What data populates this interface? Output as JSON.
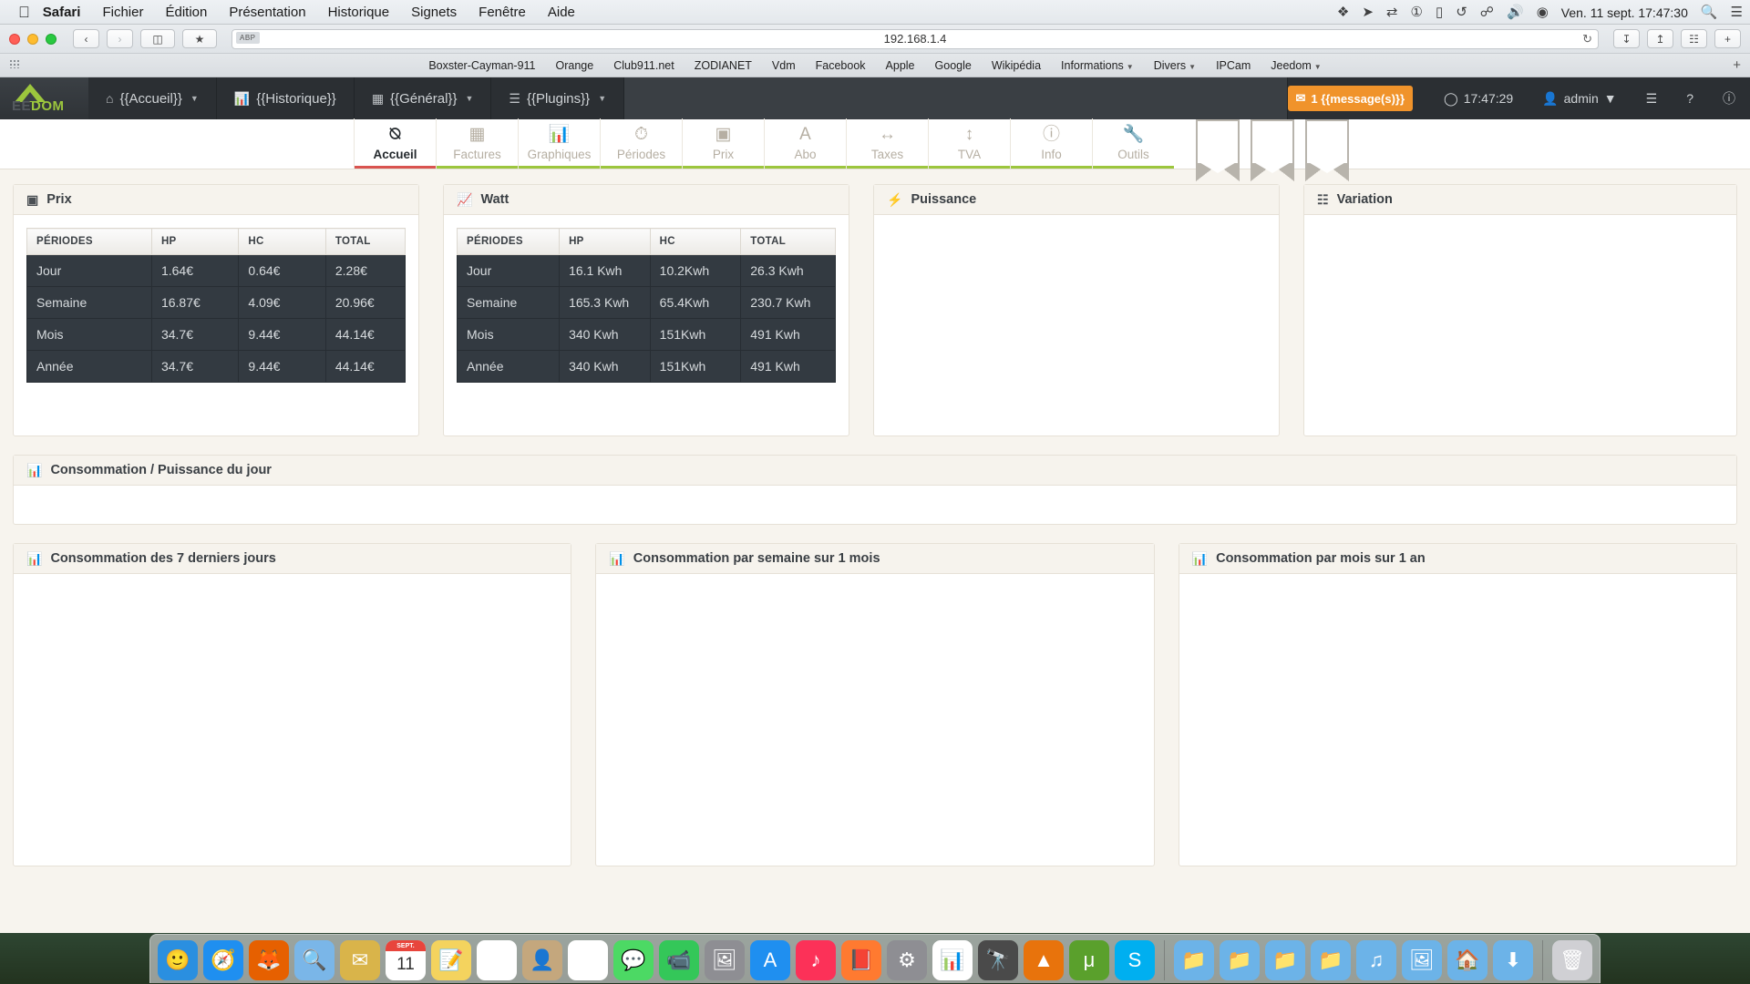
{
  "menubar": {
    "apple_icon": "apple-icon",
    "items": [
      {
        "label": "Safari",
        "bold": true
      },
      {
        "label": "Fichier",
        "bold": false
      },
      {
        "label": "Édition",
        "bold": false
      },
      {
        "label": "Présentation",
        "bold": false
      },
      {
        "label": "Historique",
        "bold": false
      },
      {
        "label": "Signets",
        "bold": false
      },
      {
        "label": "Fenêtre",
        "bold": false
      },
      {
        "label": "Aide",
        "bold": false
      }
    ],
    "status_icons": [
      "dropbox-icon",
      "chevron-right-icon",
      "teamviewer-icon",
      "one-password-icon",
      "airplay-icon",
      "time-machine-icon",
      "bluetooth-icon",
      "volume-icon",
      "wifi-icon"
    ],
    "clock": "Ven. 11 sept. 17:47:30",
    "search_icon": "search-icon",
    "control_center_icon": "list-icon"
  },
  "safari_toolbar": {
    "back_label": "‹",
    "forward_label": "›",
    "sidebar_icon": "sidebar-icon",
    "bookmarks_icon": "star-icon",
    "reader_badge": "ABP",
    "url": "192.168.1.4",
    "reload_icon": "reload-icon",
    "download_icon": "download-icon",
    "share_icon": "share-icon",
    "tabs_icon": "tabs-icon",
    "new_tab_icon": "plus-icon"
  },
  "bookmarks_bar": [
    {
      "label": "Boxster-Cayman-911",
      "dropdown": false
    },
    {
      "label": "Orange",
      "dropdown": false
    },
    {
      "label": "Club911.net",
      "dropdown": false
    },
    {
      "label": "ZODIANET",
      "dropdown": false
    },
    {
      "label": "Vdm",
      "dropdown": false
    },
    {
      "label": "Facebook",
      "dropdown": false
    },
    {
      "label": "Apple",
      "dropdown": false
    },
    {
      "label": "Google",
      "dropdown": false
    },
    {
      "label": "Wikipédia",
      "dropdown": false
    },
    {
      "label": "Informations",
      "dropdown": true
    },
    {
      "label": "Divers",
      "dropdown": true
    },
    {
      "label": "IPCam",
      "dropdown": false
    },
    {
      "label": "Jeedom",
      "dropdown": true
    }
  ],
  "jeedom_nav": {
    "logo": {
      "dim": "EE",
      "lime": "DOM",
      "full": "JEEDOM"
    },
    "items": [
      {
        "label": "{{Accueil}}",
        "icon": "home-icon",
        "dropdown": true
      },
      {
        "label": "{{Historique}}",
        "icon": "chart-bar-icon",
        "dropdown": false
      },
      {
        "label": "{{Général}}",
        "icon": "qrcode-icon",
        "dropdown": true
      },
      {
        "label": "{{Plugins}}",
        "icon": "list-icon",
        "dropdown": true
      }
    ],
    "message_badge": {
      "icon": "envelope-icon",
      "label": "1 {{message(s)}}"
    },
    "clock": {
      "icon": "clock-icon",
      "label": "17:47:29"
    },
    "user": {
      "icon": "user-icon",
      "label": "admin",
      "dropdown": true
    },
    "right_icons": [
      "sitemap-icon",
      "help-icon",
      "info-icon"
    ]
  },
  "tabs": [
    {
      "label": "Accueil",
      "icon": "dashboard-icon",
      "active": true
    },
    {
      "label": "Factures",
      "icon": "table-icon",
      "active": false
    },
    {
      "label": "Graphiques",
      "icon": "bar-chart-icon",
      "active": false
    },
    {
      "label": "Périodes",
      "icon": "clock-icon",
      "active": false
    },
    {
      "label": "Prix",
      "icon": "money-icon",
      "active": false
    },
    {
      "label": "Abo",
      "icon": "font-icon",
      "active": false
    },
    {
      "label": "Taxes",
      "icon": "text-width-icon",
      "active": false
    },
    {
      "label": "TVA",
      "icon": "text-height-icon",
      "active": false
    },
    {
      "label": "Info",
      "icon": "info-circle-icon",
      "active": false
    },
    {
      "label": "Outils",
      "icon": "wrench-icon",
      "active": false
    }
  ],
  "bookmark_shapes": [
    "bookmark-icon",
    "bookmark-icon",
    "bookmark-icon"
  ],
  "panels": {
    "prix": {
      "title": "Prix",
      "icon": "money-icon",
      "headers": [
        "PÉRIODES",
        "HP",
        "HC",
        "TOTAL"
      ],
      "rows": [
        [
          "Jour",
          "1.64€",
          "0.64€",
          "2.28€"
        ],
        [
          "Semaine",
          "16.87€",
          "4.09€",
          "20.96€"
        ],
        [
          "Mois",
          "34.7€",
          "9.44€",
          "44.14€"
        ],
        [
          "Année",
          "34.7€",
          "9.44€",
          "44.14€"
        ]
      ]
    },
    "watt": {
      "title": "Watt",
      "icon": "signal-icon",
      "headers": [
        "PÉRIODES",
        "HP",
        "HC",
        "TOTAL"
      ],
      "rows": [
        [
          "Jour",
          "16.1 Kwh",
          "10.2Kwh",
          "26.3 Kwh"
        ],
        [
          "Semaine",
          "165.3 Kwh",
          "65.4Kwh",
          "230.7 Kwh"
        ],
        [
          "Mois",
          "340 Kwh",
          "151Kwh",
          "491 Kwh"
        ],
        [
          "Année",
          "340 Kwh",
          "151Kwh",
          "491 Kwh"
        ]
      ]
    },
    "puissance": {
      "title": "Puissance",
      "icon": "bolt-icon"
    },
    "variation": {
      "title": "Variation",
      "icon": "list-alt-icon"
    },
    "conso_jour": {
      "title": "Consommation / Puissance du jour",
      "icon": "bar-chart-icon"
    },
    "conso_7j": {
      "title": "Consommation des 7 derniers jours",
      "icon": "bar-chart-icon"
    },
    "conso_semaine": {
      "title": "Consommation par semaine sur 1 mois",
      "icon": "bar-chart-icon"
    },
    "conso_mois": {
      "title": "Consommation par mois sur 1 an",
      "icon": "bar-chart-icon"
    }
  },
  "colors": {
    "accent_lime": "#9cc63d",
    "active_tab_underline": "#d9534f",
    "badge_orange": "#f0932b",
    "navbar_dark": "#2b2f33",
    "table_row_dark": "#333a41",
    "page_bg": "#f7f4ee"
  },
  "dock": {
    "items": [
      {
        "name": "finder-icon",
        "glyph": "🙂",
        "color": "#2a8fe0"
      },
      {
        "name": "safari-icon",
        "glyph": "🧭",
        "color": "#1f8ff0"
      },
      {
        "name": "firefox-icon",
        "glyph": "🦊",
        "color": "#e66000"
      },
      {
        "name": "preview-icon",
        "glyph": "🔍",
        "color": "#7ab6e8"
      },
      {
        "name": "mail-icon",
        "glyph": "✉",
        "color": "#d9b44a"
      },
      {
        "name": "calendar-icon",
        "glyph": "11",
        "color": "#ffffff",
        "cal_month": "SEPT."
      },
      {
        "name": "notes-icon",
        "glyph": "📝",
        "color": "#f4d35e"
      },
      {
        "name": "numbers-icon",
        "glyph": "▦",
        "color": "#ffffff"
      },
      {
        "name": "contacts-icon",
        "glyph": "👤",
        "color": "#c4a77d"
      },
      {
        "name": "photos-icon",
        "glyph": "✿",
        "color": "#ffffff"
      },
      {
        "name": "messages-icon",
        "glyph": "💬",
        "color": "#4cd964"
      },
      {
        "name": "facetime-icon",
        "glyph": "📹",
        "color": "#34c759"
      },
      {
        "name": "screenshot-icon",
        "glyph": "🖼",
        "color": "#8e8e93"
      },
      {
        "name": "appstore-icon",
        "glyph": "A",
        "color": "#1f8ff0"
      },
      {
        "name": "itunes-icon",
        "glyph": "♪",
        "color": "#fc3158"
      },
      {
        "name": "ibooks-icon",
        "glyph": "📕",
        "color": "#ff7a30"
      },
      {
        "name": "settings-icon",
        "glyph": "⚙",
        "color": "#8e8e93"
      },
      {
        "name": "activity-icon",
        "glyph": "📊",
        "color": "#ffffff"
      },
      {
        "name": "telescope-icon",
        "glyph": "🔭",
        "color": "#4a4a4a"
      },
      {
        "name": "vlc-icon",
        "glyph": "▲",
        "color": "#e8730c"
      },
      {
        "name": "utorrent-icon",
        "glyph": "μ",
        "color": "#5aa02c"
      },
      {
        "name": "skype-icon",
        "glyph": "S",
        "color": "#00aff0"
      },
      {
        "name": "folder-icon",
        "glyph": "📁",
        "color": "#6cb3e8"
      },
      {
        "name": "folder-icon",
        "glyph": "📁",
        "color": "#6cb3e8"
      },
      {
        "name": "folder-icon",
        "glyph": "📁",
        "color": "#6cb3e8"
      },
      {
        "name": "folder-icon",
        "glyph": "📁",
        "color": "#6cb3e8"
      },
      {
        "name": "music-folder-icon",
        "glyph": "♫",
        "color": "#6cb3e8"
      },
      {
        "name": "pictures-folder-icon",
        "glyph": "🖼",
        "color": "#6cb3e8"
      },
      {
        "name": "home-folder-icon",
        "glyph": "🏠",
        "color": "#6cb3e8"
      },
      {
        "name": "downloads-folder-icon",
        "glyph": "⬇",
        "color": "#6cb3e8"
      },
      {
        "name": "trash-icon",
        "glyph": "🗑",
        "color": "#d0d0d4"
      }
    ]
  }
}
